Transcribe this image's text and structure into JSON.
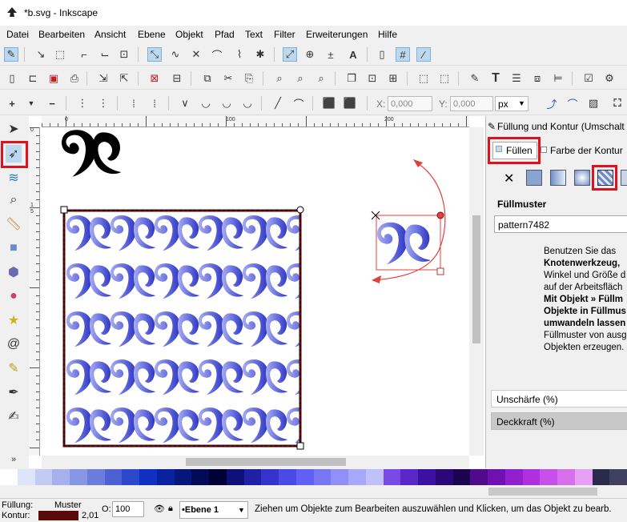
{
  "window": {
    "title": "*b.svg - Inkscape"
  },
  "menu": [
    "Datei",
    "Bearbeiten",
    "Ansicht",
    "Ebene",
    "Objekt",
    "Pfad",
    "Text",
    "Filter",
    "Erweiterungen",
    "Hilfe"
  ],
  "toolbar3": {
    "x_label": "X:",
    "x_value": "0,000",
    "y_label": "Y:",
    "y_value": "0,000",
    "unit": "px"
  },
  "ruler": {
    "h_labels": [
      "0",
      "100",
      "200"
    ],
    "v_labels": [
      "0",
      "1",
      "5"
    ]
  },
  "panel": {
    "title": "Füllung und Kontur (Umschalt",
    "tab_fill": "Füllen",
    "tab_stroke": "Farbe der Kontur",
    "section": "Füllmuster",
    "pattern_value": "pattern7482",
    "help": [
      "Benutzen Sie das",
      "Knotenwerkzeug,",
      "Winkel und Größe d",
      "auf der Arbeitsfläch",
      "Mit Objekt » Füllm",
      "Objekte in Füllmus",
      "umwandeln lassen",
      "Füllmuster von ausg",
      "Objekten erzeugen."
    ],
    "blur_label": "Unschärfe (%)",
    "opacity_label": "Deckkraft (%)"
  },
  "status": {
    "fill_label": "Füllung:",
    "fill_value": "Muster",
    "stroke_label": "Kontur:",
    "stroke_width": "2,01",
    "opacity_label": "O:",
    "opacity_value": "100",
    "layer": "•Ebene 1",
    "message": "Ziehen um Objekte zum Bearbeiten auszuwählen und Klicken, um das Objekt zu bearb."
  },
  "colors": {
    "accent_red": "#e0101c",
    "pattern_blue": "#4a4fd0",
    "stroke_dark": "#5a0a0a"
  },
  "palette": [
    "#ffffff",
    "#e0e4f8",
    "#c4cbf2",
    "#a6b0ec",
    "#8896e4",
    "#6a7cdc",
    "#4c62d4",
    "#2e48cc",
    "#1030c4",
    "#0a22a0",
    "#06167c",
    "#030b58",
    "#000036",
    "#10107a",
    "#2020a6",
    "#3434cc",
    "#4a4ae6",
    "#6060f2",
    "#7878f4",
    "#9090f6",
    "#a8a8f8",
    "#c0c0fa",
    "#7a4ae6",
    "#5a28c8",
    "#3c10a0",
    "#2a0878",
    "#1a0450",
    "#500a8a",
    "#7010b0",
    "#9020d0",
    "#b030e0",
    "#c850e8",
    "#d870ee",
    "#e8a0f4",
    "#2a2a4a",
    "#404060"
  ]
}
